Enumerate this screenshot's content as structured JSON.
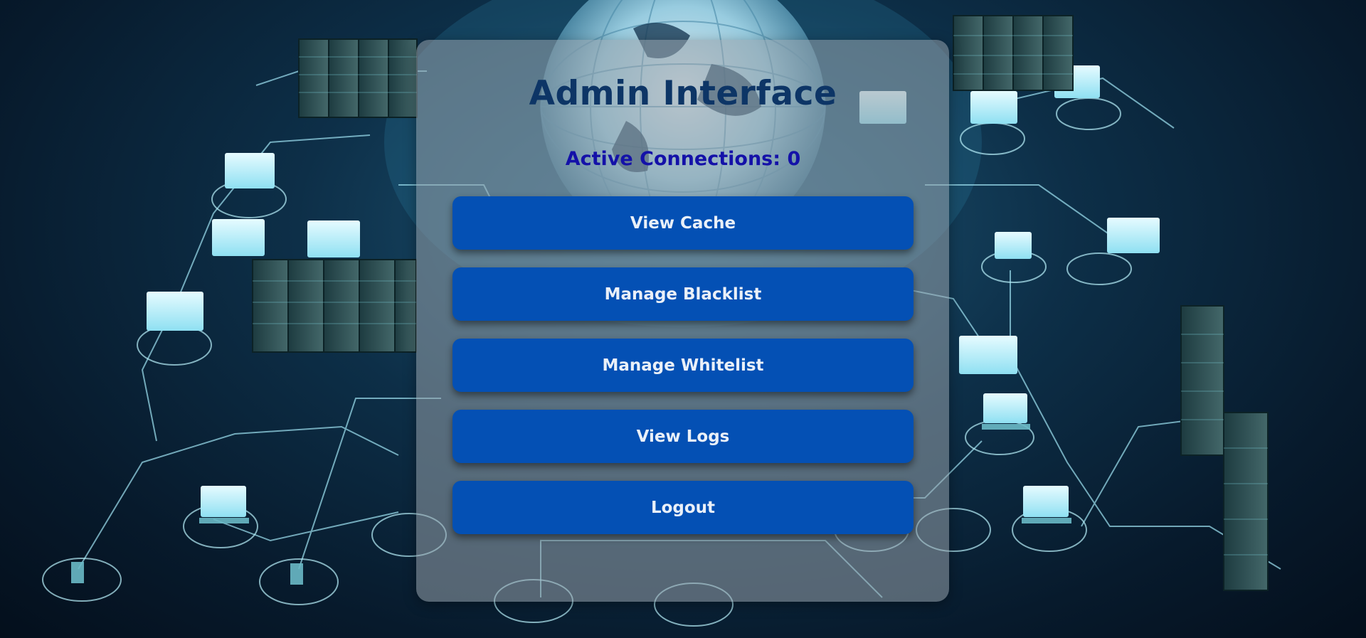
{
  "page": {
    "title": "Admin Interface",
    "active_connections": "Active Connections: 0"
  },
  "menu": {
    "buttons": [
      {
        "label": "View Cache"
      },
      {
        "label": "Manage Blacklist"
      },
      {
        "label": "Manage Whitelist"
      },
      {
        "label": "View Logs"
      },
      {
        "label": "Logout"
      }
    ]
  },
  "colors": {
    "button": "#0450b4",
    "title": "#0d3566",
    "connections": "#1411a8"
  },
  "icons": [
    "network-background-image"
  ]
}
